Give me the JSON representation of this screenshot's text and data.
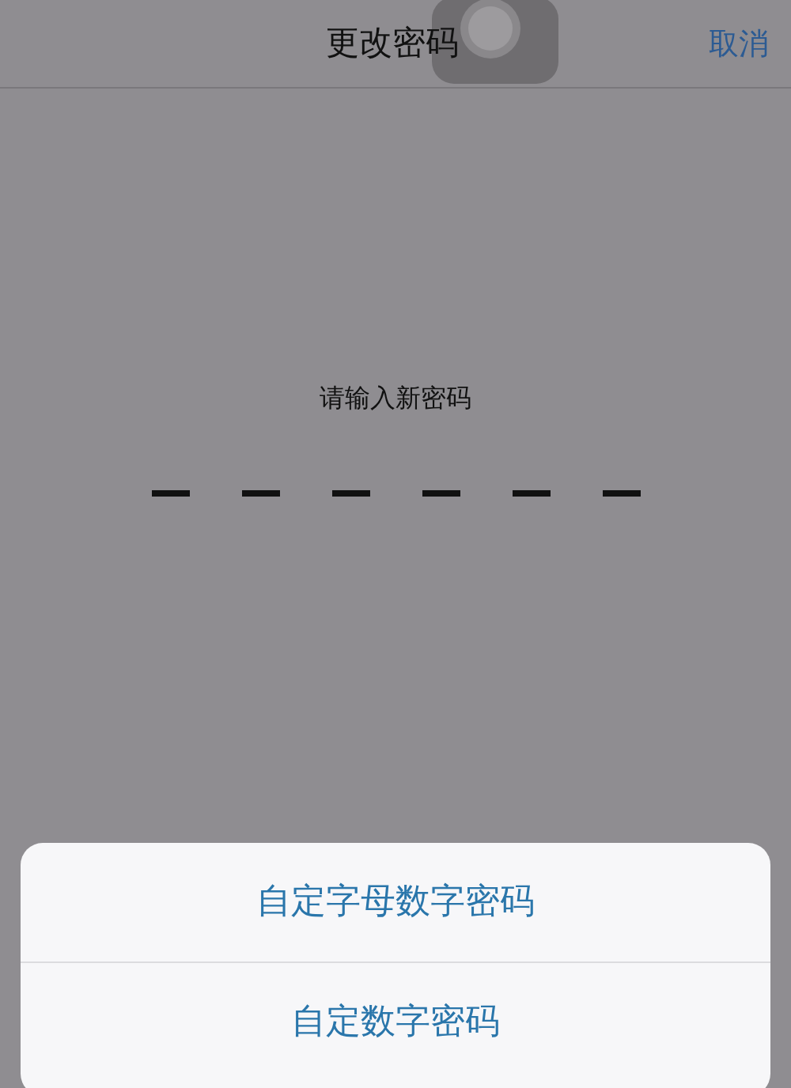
{
  "nav_bar": {
    "title": "更改密码",
    "cancel": "取消"
  },
  "prompt": "请输入新密码",
  "digits": [
    {
      "filled": false
    },
    {
      "filled": false
    },
    {
      "filled": false
    },
    {
      "filled": false
    },
    {
      "filled": false
    },
    {
      "filled": false
    }
  ],
  "action_sheet": {
    "options": [
      "自定字母数字密码",
      "自定数字密码"
    ]
  }
}
